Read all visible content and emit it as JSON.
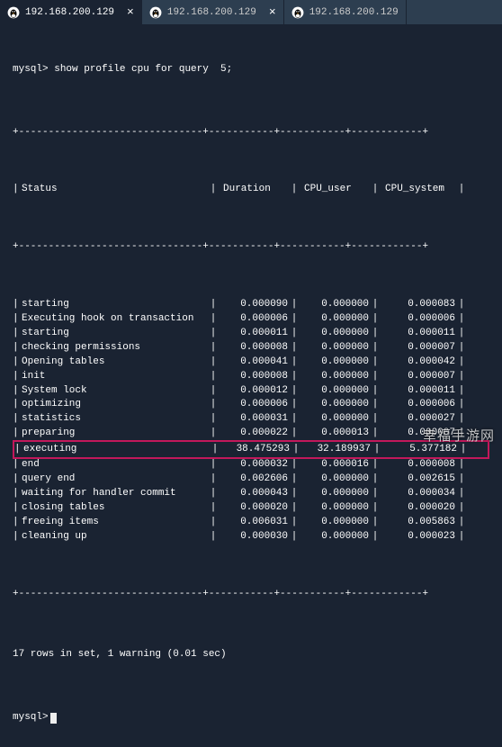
{
  "tabs": [
    {
      "label": "192.168.200.129",
      "active": true,
      "closeable": true
    },
    {
      "label": "192.168.200.129",
      "active": false,
      "closeable": true
    },
    {
      "label": "192.168.200.129",
      "active": false,
      "closeable": false
    }
  ],
  "prompt": "mysql>",
  "command": "show profile cpu for query  5;",
  "separator_top": "+-------------------------------+-----------+-----------+------------+",
  "separator_bottom": "+-------------------------------+-----------+-----------+------------+",
  "headers": {
    "status": "Status",
    "duration": "Duration",
    "cpu_user": "CPU_user",
    "cpu_system": "CPU_system"
  },
  "rows": [
    {
      "status": "starting",
      "duration": "0.000090",
      "cpu_user": "0.000000",
      "cpu_system": "0.000083",
      "highlight": false
    },
    {
      "status": "Executing hook on transaction",
      "duration": "0.000006",
      "cpu_user": "0.000000",
      "cpu_system": "0.000006",
      "highlight": false
    },
    {
      "status": "starting",
      "duration": "0.000011",
      "cpu_user": "0.000000",
      "cpu_system": "0.000011",
      "highlight": false
    },
    {
      "status": "checking permissions",
      "duration": "0.000008",
      "cpu_user": "0.000000",
      "cpu_system": "0.000007",
      "highlight": false
    },
    {
      "status": "Opening tables",
      "duration": "0.000041",
      "cpu_user": "0.000000",
      "cpu_system": "0.000042",
      "highlight": false
    },
    {
      "status": "init",
      "duration": "0.000008",
      "cpu_user": "0.000000",
      "cpu_system": "0.000007",
      "highlight": false
    },
    {
      "status": "System lock",
      "duration": "0.000012",
      "cpu_user": "0.000000",
      "cpu_system": "0.000011",
      "highlight": false
    },
    {
      "status": "optimizing",
      "duration": "0.000006",
      "cpu_user": "0.000000",
      "cpu_system": "0.000006",
      "highlight": false
    },
    {
      "status": "statistics",
      "duration": "0.000031",
      "cpu_user": "0.000000",
      "cpu_system": "0.000027",
      "highlight": false
    },
    {
      "status": "preparing",
      "duration": "0.000022",
      "cpu_user": "0.000013",
      "cpu_system": "0.000007",
      "highlight": false
    },
    {
      "status": "executing",
      "duration": "38.475293",
      "cpu_user": "32.189937",
      "cpu_system": "5.377182",
      "highlight": true
    },
    {
      "status": "end",
      "duration": "0.000032",
      "cpu_user": "0.000016",
      "cpu_system": "0.000008",
      "highlight": false
    },
    {
      "status": "query end",
      "duration": "0.002606",
      "cpu_user": "0.000000",
      "cpu_system": "0.002615",
      "highlight": false
    },
    {
      "status": "waiting for handler commit",
      "duration": "0.000043",
      "cpu_user": "0.000000",
      "cpu_system": "0.000034",
      "highlight": false
    },
    {
      "status": "closing tables",
      "duration": "0.000020",
      "cpu_user": "0.000000",
      "cpu_system": "0.000020",
      "highlight": false
    },
    {
      "status": "freeing items",
      "duration": "0.006031",
      "cpu_user": "0.000000",
      "cpu_system": "0.005863",
      "highlight": false
    },
    {
      "status": "cleaning up",
      "duration": "0.000030",
      "cpu_user": "0.000000",
      "cpu_system": "0.000023",
      "highlight": false
    }
  ],
  "summary": "17 rows in set, 1 warning (0.01 sec)",
  "watermark": "幸福手游网"
}
